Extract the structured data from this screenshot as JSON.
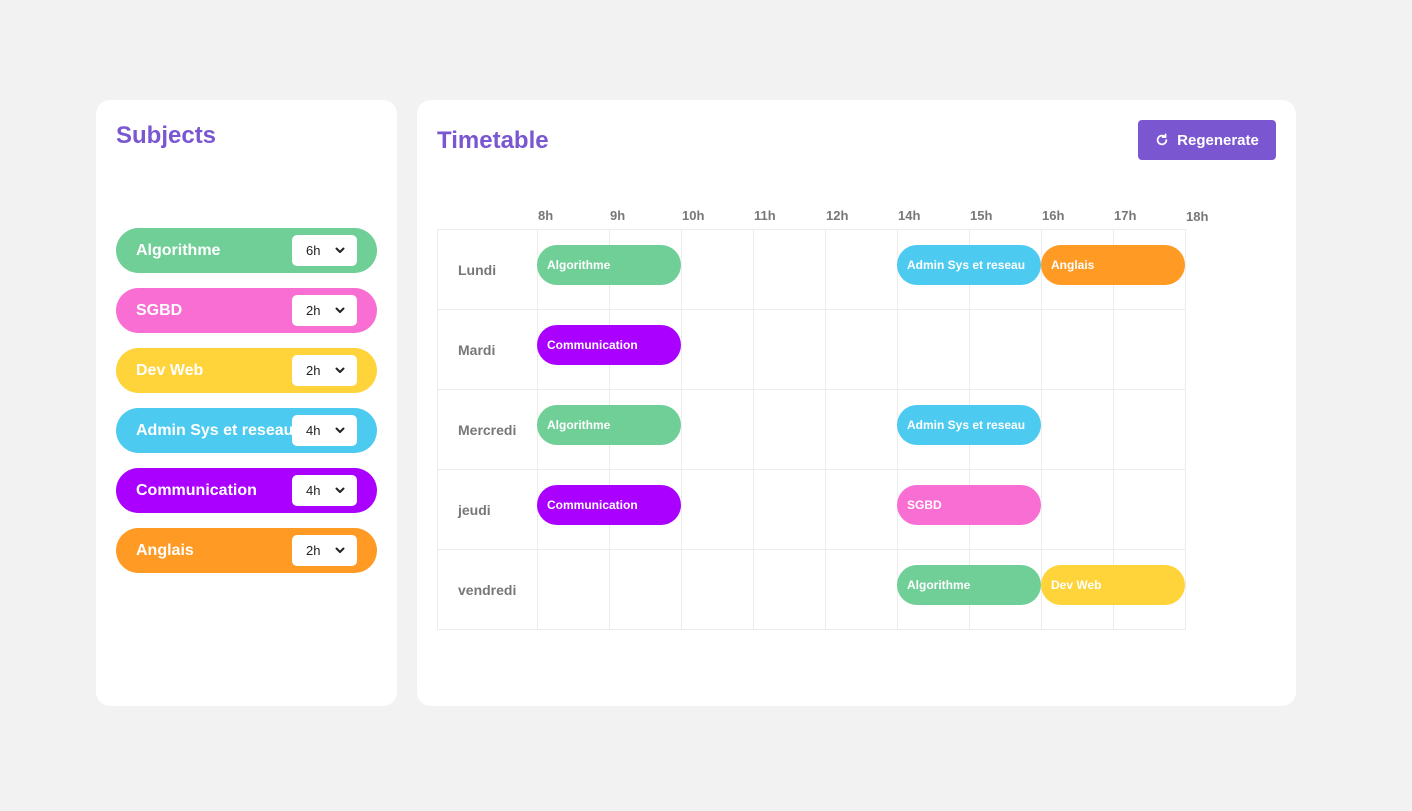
{
  "subjects_panel": {
    "title": "Subjects",
    "subjects": [
      {
        "name": "Algorithme",
        "hours": "6h",
        "color": "#6fcf97"
      },
      {
        "name": "SGBD",
        "hours": "2h",
        "color": "#f96ed3"
      },
      {
        "name": "Dev Web",
        "hours": "2h",
        "color": "#ffd43b"
      },
      {
        "name": "Admin Sys et reseau",
        "hours": "4h",
        "color": "#4ccaef"
      },
      {
        "name": "Communication",
        "hours": "4h",
        "color": "#aa00ff"
      },
      {
        "name": "Anglais",
        "hours": "2h",
        "color": "#ff9a24"
      }
    ]
  },
  "timetable_panel": {
    "title": "Timetable",
    "regenerate_label": "Regenerate",
    "regenerate_color": "#7a57d1",
    "hours": [
      "8h",
      "9h",
      "10h",
      "11h",
      "12h",
      "14h",
      "15h",
      "16h",
      "17h",
      "18h"
    ],
    "days": [
      {
        "name": "Lundi",
        "slots": [
          {
            "subject": "Algorithme",
            "start_index": 0,
            "span": 2,
            "color": "#6fcf97"
          },
          {
            "subject": "Admin Sys et reseau",
            "start_index": 5,
            "span": 2,
            "color": "#4ccaef"
          },
          {
            "subject": "Anglais",
            "start_index": 7,
            "span": 2,
            "color": "#ff9a24"
          }
        ]
      },
      {
        "name": "Mardi",
        "slots": [
          {
            "subject": "Communication",
            "start_index": 0,
            "span": 2,
            "color": "#aa00ff"
          }
        ]
      },
      {
        "name": "Mercredi",
        "slots": [
          {
            "subject": "Algorithme",
            "start_index": 0,
            "span": 2,
            "color": "#6fcf97"
          },
          {
            "subject": "Admin Sys et reseau",
            "start_index": 5,
            "span": 2,
            "color": "#4ccaef"
          }
        ]
      },
      {
        "name": "jeudi",
        "slots": [
          {
            "subject": "Communication",
            "start_index": 0,
            "span": 2,
            "color": "#aa00ff"
          },
          {
            "subject": "SGBD",
            "start_index": 5,
            "span": 2,
            "color": "#f96ed3"
          }
        ]
      },
      {
        "name": "vendredi",
        "slots": [
          {
            "subject": "Algorithme",
            "start_index": 5,
            "span": 2,
            "color": "#6fcf97"
          },
          {
            "subject": "Dev Web",
            "start_index": 7,
            "span": 2,
            "color": "#ffd43b"
          }
        ]
      }
    ]
  },
  "icons": {
    "refresh": "refresh-icon",
    "chevron": "chevron-down-icon"
  }
}
